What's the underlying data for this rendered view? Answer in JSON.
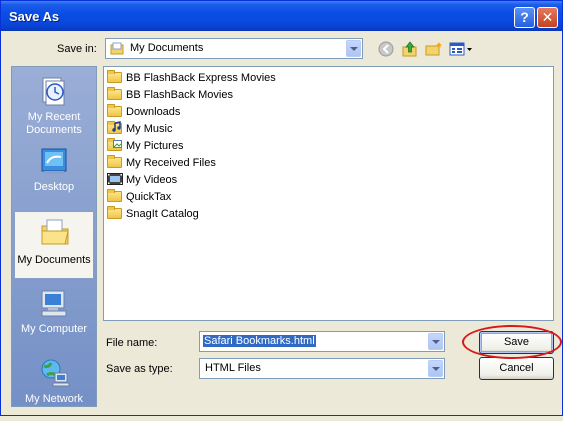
{
  "window": {
    "title": "Save As"
  },
  "titlebar": {
    "help_glyph": "?",
    "close_glyph": "✕"
  },
  "save_in": {
    "label": "Save in:",
    "value": "My Documents"
  },
  "places": [
    {
      "label": "My Recent Documents",
      "icon": "recent-documents-icon"
    },
    {
      "label": "Desktop",
      "icon": "desktop-icon"
    },
    {
      "label": "My Documents",
      "icon": "my-documents-icon",
      "active": true
    },
    {
      "label": "My Computer",
      "icon": "my-computer-icon"
    },
    {
      "label": "My Network",
      "icon": "my-network-icon"
    }
  ],
  "files": [
    {
      "name": "BB FlashBack Express Movies",
      "icon": "folder-icon"
    },
    {
      "name": "BB FlashBack Movies",
      "icon": "folder-icon"
    },
    {
      "name": "Downloads",
      "icon": "folder-icon"
    },
    {
      "name": "My Music",
      "icon": "music-folder-icon"
    },
    {
      "name": "My Pictures",
      "icon": "pictures-folder-icon"
    },
    {
      "name": "My Received Files",
      "icon": "folder-icon"
    },
    {
      "name": "My Videos",
      "icon": "videos-folder-icon"
    },
    {
      "name": "QuickTax",
      "icon": "folder-icon"
    },
    {
      "name": "SnagIt Catalog",
      "icon": "folder-icon"
    }
  ],
  "file_name": {
    "label": "File name:",
    "value": "Safari Bookmarks.html"
  },
  "save_type": {
    "label": "Save as type:",
    "value": "HTML Files"
  },
  "buttons": {
    "save": "Save",
    "cancel": "Cancel"
  },
  "colors": {
    "title_bar": "#0a4ee6",
    "annotation": "#d61a1a",
    "selection": "#316ac5"
  }
}
